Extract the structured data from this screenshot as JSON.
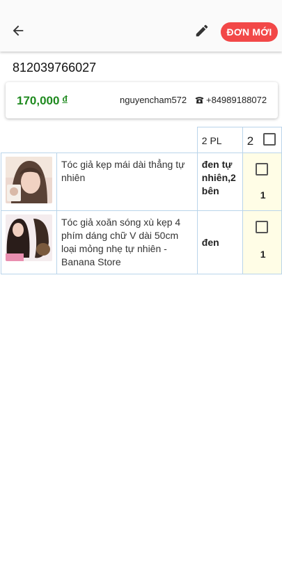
{
  "header": {
    "back_icon": "arrow-left-icon",
    "edit_icon": "pencil-icon",
    "new_order_label": "ĐƠN MỚI",
    "new_order_color": "#f24848"
  },
  "order": {
    "code": "812039766027",
    "total": "170,000",
    "currency": "đ",
    "username": "nguyencham572",
    "phone_icon": "telephone-icon",
    "phone": "+84989188072",
    "total_color": "#1f8a1f"
  },
  "table": {
    "variant_count_label": "2 PL",
    "total_qty": "2",
    "rows": [
      {
        "name": "Tóc giả kẹp mái dài thẳng tự nhiên",
        "variant": "đen tự nhiên,2 bên",
        "qty": "1"
      },
      {
        "name": "Tóc giả xoăn sóng xù kẹp 4 phím dáng chữ V dài 50cm loại mỏng nhẹ tự nhiên - Banana Store",
        "variant": "đen",
        "qty": "1"
      }
    ]
  }
}
